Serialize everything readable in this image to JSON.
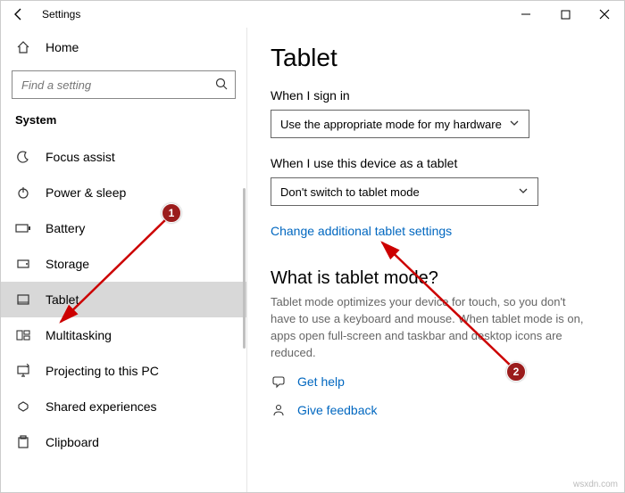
{
  "titlebar": {
    "app_title": "Settings"
  },
  "sidebar": {
    "home_label": "Home",
    "search_placeholder": "Find a setting",
    "section": "System",
    "items": [
      {
        "label": "Focus assist",
        "icon": "☾"
      },
      {
        "label": "Power & sleep",
        "icon": "⏻"
      },
      {
        "label": "Battery",
        "icon": "▭"
      },
      {
        "label": "Storage",
        "icon": "🖴"
      },
      {
        "label": "Tablet",
        "icon": "⬚",
        "selected": true
      },
      {
        "label": "Multitasking",
        "icon": "⊞"
      },
      {
        "label": "Projecting to this PC",
        "icon": "⎚"
      },
      {
        "label": "Shared experiences",
        "icon": "✶"
      },
      {
        "label": "Clipboard",
        "icon": "📋"
      }
    ]
  },
  "content": {
    "page_title": "Tablet",
    "signin_label": "When I sign in",
    "signin_value": "Use the appropriate mode for my hardware",
    "tablet_use_label": "When I use this device as a tablet",
    "tablet_use_value": "Don't switch to tablet mode",
    "change_link": "Change additional tablet settings",
    "what_heading": "What is tablet mode?",
    "what_desc": "Tablet mode optimizes your device for touch, so you don't have to use a keyboard and mouse. When tablet mode is on, apps open full-screen and taskbar and desktop icons are reduced.",
    "get_help": "Get help",
    "give_feedback": "Give feedback"
  },
  "annotations": {
    "badge1": "1",
    "badge2": "2"
  },
  "watermark": "wsxdn.com"
}
